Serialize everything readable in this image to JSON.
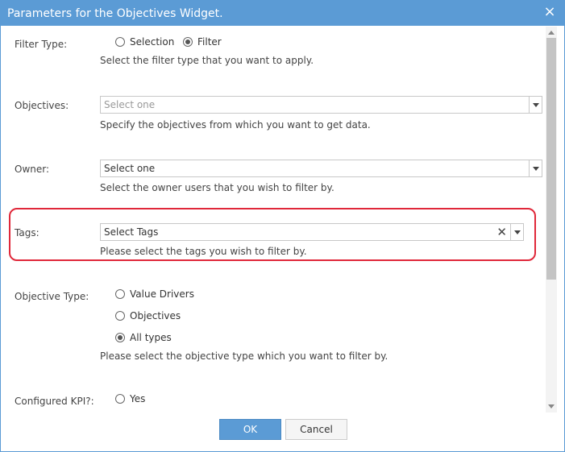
{
  "dialog": {
    "title": "Parameters for the Objectives Widget.",
    "close_symbol": "×"
  },
  "filter_type": {
    "label": "Filter Type:",
    "options": [
      {
        "label": "Selection",
        "checked": false
      },
      {
        "label": "Filter",
        "checked": true
      }
    ],
    "help": "Select the filter type that you want to apply."
  },
  "objectives": {
    "label": "Objectives:",
    "placeholder": "Select one",
    "help": "Specify the objectives from which you want to get data."
  },
  "owner": {
    "label": "Owner:",
    "value": "Select one",
    "help": "Select the owner users that you wish to filter by."
  },
  "tags": {
    "label": "Tags:",
    "placeholder": "Select Tags",
    "clear_symbol": "✕",
    "help": "Please select the tags you wish to filter by."
  },
  "objective_type": {
    "label": "Objective Type:",
    "options": [
      {
        "label": "Value Drivers",
        "checked": false
      },
      {
        "label": "Objectives",
        "checked": false
      },
      {
        "label": "All types",
        "checked": true
      }
    ],
    "help": "Please select the objective type which you want to filter by."
  },
  "configured_kpi": {
    "label": "Configured KPI?:",
    "options": [
      {
        "label": "Yes",
        "checked": false
      }
    ]
  },
  "buttons": {
    "ok": "OK",
    "cancel": "Cancel"
  },
  "colors": {
    "title_bar": "#5b9bd5",
    "highlight": "#e0283a"
  }
}
